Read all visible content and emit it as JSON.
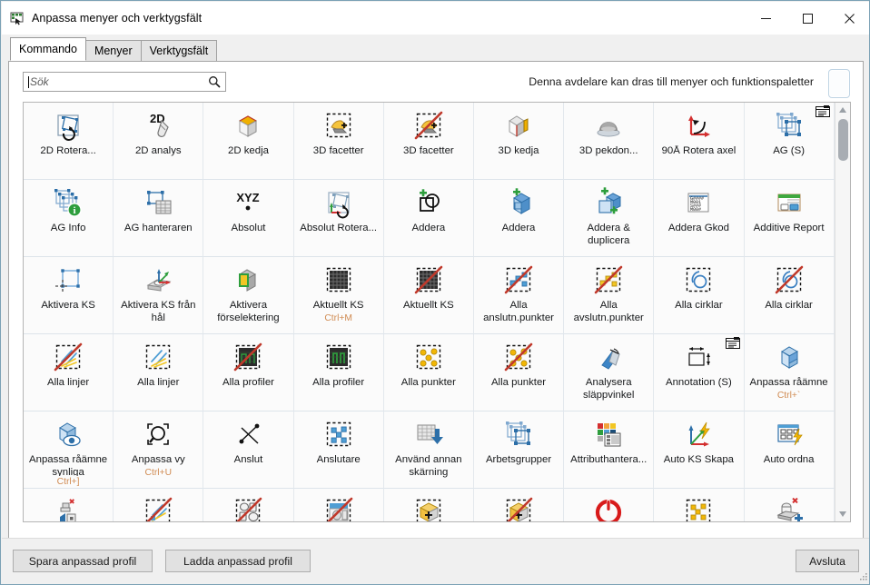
{
  "window": {
    "title": "Anpassa menyer och verktygsfält",
    "icon": "customize-toolbar-icon",
    "minimize_label": "–",
    "maximize_label": "□",
    "close_label": "✕"
  },
  "tabs": [
    {
      "label": "Kommando",
      "active": true
    },
    {
      "label": "Menyer",
      "active": false
    },
    {
      "label": "Verktygsfält",
      "active": false
    }
  ],
  "search": {
    "value": "",
    "placeholder": "Sök",
    "icon": "search-icon"
  },
  "hint": {
    "text": "Denna avdelare kan dras till menyer och funktionspaletter",
    "handle_name": "divider-drag-handle"
  },
  "scrollbar": {
    "up_arrow": "▲",
    "down_arrow": "▼"
  },
  "commands": [
    {
      "label": "2D Rotera...",
      "icon": "rotate-2d-icon",
      "shortcut": ""
    },
    {
      "label": "2D analys",
      "icon": "mouse-2d-icon",
      "shortcut": ""
    },
    {
      "label": "2D kedja",
      "icon": "cube-top-yellow-icon",
      "shortcut": ""
    },
    {
      "label": "3D facetter",
      "icon": "facet-add-icon",
      "shortcut": ""
    },
    {
      "label": "3D facetter",
      "icon": "facet-add-off-icon",
      "shortcut": ""
    },
    {
      "label": "3D kedja",
      "icon": "cube-side-yellow-icon",
      "shortcut": ""
    },
    {
      "label": "3D pekdon...",
      "icon": "spacemouse-icon",
      "shortcut": ""
    },
    {
      "label": "90Å  Rotera axel",
      "icon": "rotate-axis-icon",
      "shortcut": ""
    },
    {
      "label": "AG (S)",
      "icon": "workgroup-select-icon",
      "shortcut": "",
      "badge": "window-badge-icon"
    },
    {
      "label": "AG Info",
      "icon": "workgroup-info-icon",
      "shortcut": ""
    },
    {
      "label": "AG hanteraren",
      "icon": "workgroup-manager-icon",
      "shortcut": ""
    },
    {
      "label": "Absolut",
      "icon": "xyz-absolute-icon",
      "shortcut": ""
    },
    {
      "label": "Absolut Rotera...",
      "icon": "absolute-rotate-icon",
      "shortcut": ""
    },
    {
      "label": "Addera",
      "icon": "add-shape-icon",
      "shortcut": ""
    },
    {
      "label": "Addera",
      "icon": "add-cube-icon",
      "shortcut": ""
    },
    {
      "label": "Addera & duplicera",
      "icon": "add-duplicate-icon",
      "shortcut": ""
    },
    {
      "label": "Addera Gkod",
      "icon": "add-gcode-icon",
      "shortcut": ""
    },
    {
      "label": "Additive Report",
      "icon": "additive-report-icon",
      "shortcut": ""
    },
    {
      "label": "Aktivera KS",
      "icon": "activate-cs-icon",
      "shortcut": ""
    },
    {
      "label": "Aktivera KS från hål",
      "icon": "activate-cs-hole-icon",
      "shortcut": ""
    },
    {
      "label": "Aktivera förselektering",
      "icon": "activate-preselect-icon",
      "shortcut": ""
    },
    {
      "label": "Aktuellt KS",
      "icon": "current-cs-icon",
      "shortcut": "Ctrl+M"
    },
    {
      "label": "Aktuellt KS",
      "icon": "current-cs-off-icon",
      "shortcut": ""
    },
    {
      "label": "Alla anslutn.punkter",
      "icon": "all-connect-points-off-icon",
      "shortcut": ""
    },
    {
      "label": "Alla avslutn.punkter",
      "icon": "all-end-points-off-icon",
      "shortcut": ""
    },
    {
      "label": "Alla cirklar",
      "icon": "all-circles-icon",
      "shortcut": ""
    },
    {
      "label": "Alla cirklar",
      "icon": "all-circles-off-icon",
      "shortcut": ""
    },
    {
      "label": "Alla linjer",
      "icon": "all-lines-off-icon",
      "shortcut": ""
    },
    {
      "label": "Alla linjer",
      "icon": "all-lines-icon",
      "shortcut": ""
    },
    {
      "label": "Alla profiler",
      "icon": "all-profiles-off-icon",
      "shortcut": ""
    },
    {
      "label": "Alla profiler",
      "icon": "all-profiles-icon",
      "shortcut": ""
    },
    {
      "label": "Alla punkter",
      "icon": "all-points-icon",
      "shortcut": ""
    },
    {
      "label": "Alla punkter",
      "icon": "all-points-off-icon",
      "shortcut": ""
    },
    {
      "label": "Analysera släppvinkel",
      "icon": "draft-angle-icon",
      "shortcut": ""
    },
    {
      "label": "Annotation (S)",
      "icon": "annotation-icon",
      "shortcut": "",
      "badge": "window-badge-icon"
    },
    {
      "label": "Anpassa råämne",
      "icon": "fit-stock-icon",
      "shortcut": "Ctrl+`"
    },
    {
      "label": "Anpassa råämne synliga",
      "icon": "fit-stock-visible-icon",
      "shortcut": "Ctrl+]"
    },
    {
      "label": "Anpassa vy",
      "icon": "zoom-fit-icon",
      "shortcut": "Ctrl+U"
    },
    {
      "label": "Anslut",
      "icon": "connect-icon",
      "shortcut": ""
    },
    {
      "label": "Anslutare",
      "icon": "connector-icon",
      "shortcut": ""
    },
    {
      "label": "Använd annan skärning",
      "icon": "use-other-cut-icon",
      "shortcut": ""
    },
    {
      "label": "Arbetsgrupper",
      "icon": "workgroups-icon",
      "shortcut": ""
    },
    {
      "label": "Attributhantera...",
      "icon": "attribute-manager-icon",
      "shortcut": ""
    },
    {
      "label": "Auto KS Skapa",
      "icon": "auto-cs-create-icon",
      "shortcut": ""
    },
    {
      "label": "Auto ordna",
      "icon": "auto-arrange-icon",
      "shortcut": ""
    },
    {
      "label": "",
      "icon": "auto-cleanup-icon",
      "shortcut": ""
    },
    {
      "label": "",
      "icon": "auto-lines-off-icon",
      "shortcut": ""
    },
    {
      "label": "",
      "icon": "auto-shapes-off-icon",
      "shortcut": ""
    },
    {
      "label": "",
      "icon": "auto-surface-off-icon",
      "shortcut": ""
    },
    {
      "label": "",
      "icon": "auto-stock-add-icon",
      "shortcut": ""
    },
    {
      "label": "",
      "icon": "auto-stock-add-off-icon",
      "shortcut": ""
    },
    {
      "label": "",
      "icon": "power-icon",
      "shortcut": ""
    },
    {
      "label": "",
      "icon": "auto-points-icon",
      "shortcut": ""
    },
    {
      "label": "",
      "icon": "auto-part-add-icon",
      "shortcut": ""
    }
  ],
  "footer": {
    "save_label": "Spara anpassad profil",
    "load_label": "Ladda anpassad profil",
    "exit_label": "Avsluta"
  },
  "colors": {
    "accent": "#0078d7",
    "window_border": "#7ba1b5",
    "shortcut": "#d08b52",
    "grid_bg": "#eef2f6"
  }
}
